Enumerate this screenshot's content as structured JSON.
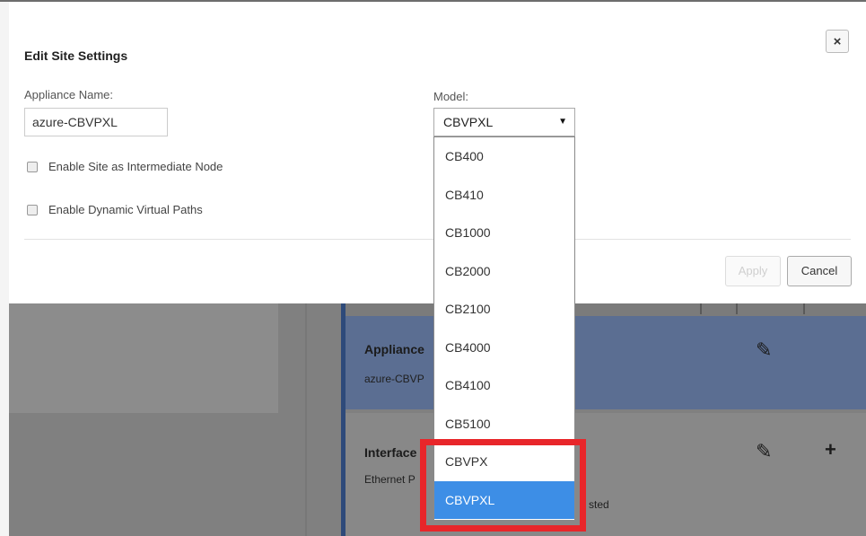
{
  "modal": {
    "title": "Edit Site Settings",
    "close_label": "×",
    "appliance_name_label": "Appliance Name:",
    "appliance_name_value": "azure-CBVPXL",
    "model_label": "Model:",
    "model_selected": "CBVPXL",
    "model_options": [
      "CB400",
      "CB410",
      "CB1000",
      "CB2000",
      "CB2100",
      "CB4000",
      "CB4100",
      "CB5100",
      "CBVPX",
      "CBVPXL"
    ],
    "checkbox_intermediate": {
      "label": "Enable Site as Intermediate Node",
      "checked": false
    },
    "checkbox_dynamic_paths": {
      "label": "Enable Dynamic Virtual Paths",
      "checked": false
    },
    "apply_label": "Apply",
    "cancel_label": "Cancel"
  },
  "background": {
    "appliance_title": "Appliance",
    "appliance_sub": "azure-CBVP",
    "interfaces_title": "Interface",
    "interfaces_sub": "Ethernet P",
    "partial_text": "sted"
  },
  "colors": {
    "highlight": "#e8262a",
    "selected_option": "#3d8ee6",
    "card_blue": "#5b6e92"
  }
}
